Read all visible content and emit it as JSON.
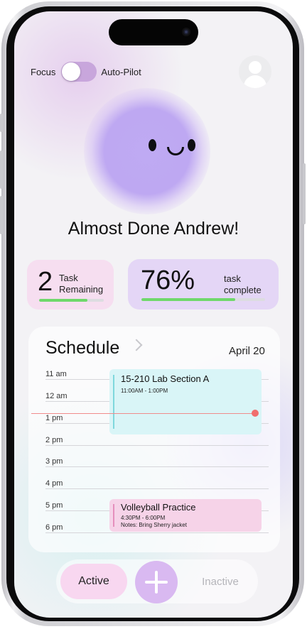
{
  "header": {
    "focus_label": "Focus",
    "autopilot_label": "Auto-Pilot",
    "toggle_state": "focus"
  },
  "greeting": "Almost Done Andrew!",
  "stats": {
    "tasks_remaining": {
      "value": "2",
      "label_line1": "Task",
      "label_line2": "Remaining",
      "progress": 0.75
    },
    "task_complete": {
      "value": "76%",
      "label_line1": "task",
      "label_line2": "complete",
      "progress": 0.76
    }
  },
  "schedule": {
    "title": "Schedule",
    "date": "April 20",
    "hours": [
      "11 am",
      "12 am",
      "1 pm",
      "2 pm",
      "3 pm",
      "4 pm",
      "5 pm",
      "6 pm"
    ],
    "events": [
      {
        "title": "15-210 Lab Section A",
        "time": "11:00AM - 1:00PM",
        "notes": "",
        "color": "#d9f5f7",
        "bar_color": "#7fd8dd"
      },
      {
        "title": "Volleyball Practice",
        "time": "4:30PM - 6:00PM",
        "notes": "Notes: Bring Sherry jacket",
        "color": "#f6d3e8",
        "bar_color": "#e58fbd"
      }
    ],
    "now_indicator_color": "#f06d6d"
  },
  "nav": {
    "active_label": "Active",
    "inactive_label": "Inactive",
    "add_icon": "plus-icon"
  },
  "colors": {
    "accent_purple": "#bea8f2",
    "progress_green": "#6fd86b"
  }
}
